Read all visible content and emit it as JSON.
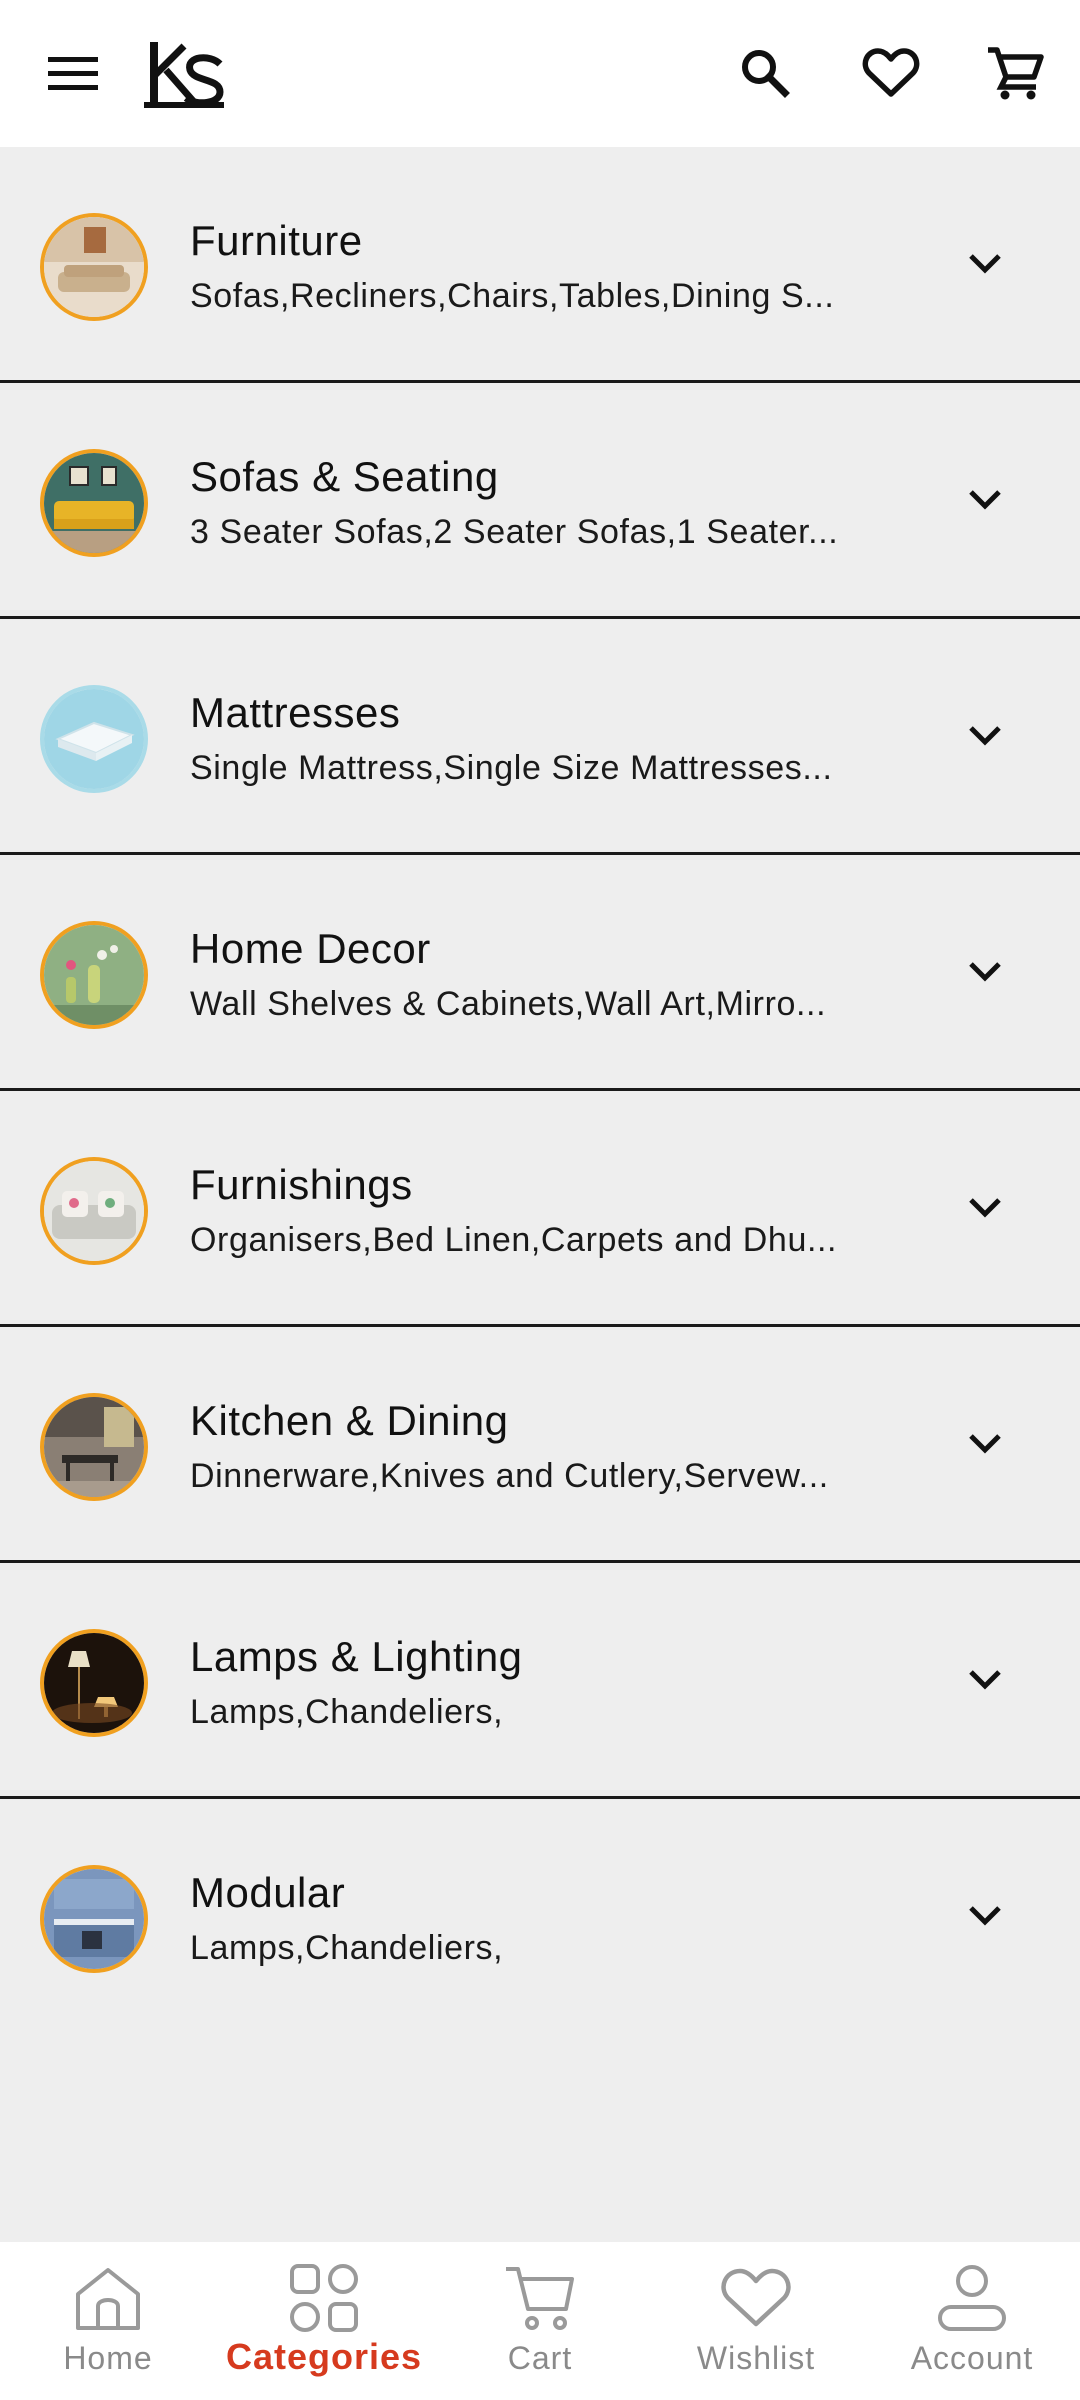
{
  "header": {
    "menu_icon": "hamburger-menu-icon",
    "logo_text": "KS",
    "actions": [
      {
        "name": "search",
        "icon": "search-icon"
      },
      {
        "name": "wishlist",
        "icon": "heart-icon"
      },
      {
        "name": "cart",
        "icon": "shopping-cart-icon"
      }
    ]
  },
  "categories": [
    {
      "title": "Furniture",
      "subtitle": "Sofas,Recliners,Chairs,Tables,Dining S..."
    },
    {
      "title": "Sofas & Seating",
      "subtitle": "3 Seater Sofas,2 Seater Sofas,1 Seater..."
    },
    {
      "title": "Mattresses",
      "subtitle": "Single Mattress,Single Size Mattresses..."
    },
    {
      "title": "Home Decor",
      "subtitle": "Wall Shelves & Cabinets,Wall Art,Mirro..."
    },
    {
      "title": "Furnishings",
      "subtitle": "Organisers,Bed Linen,Carpets and Dhu..."
    },
    {
      "title": "Kitchen & Dining",
      "subtitle": "Dinnerware,Knives and Cutlery,Servew..."
    },
    {
      "title": "Lamps & Lighting",
      "subtitle": "Lamps,Chandeliers,"
    },
    {
      "title": "Modular",
      "subtitle": "Lamps,Chandeliers,"
    }
  ],
  "bottom_nav": {
    "active": "Categories",
    "items": [
      {
        "label": "Home",
        "icon": "home-icon"
      },
      {
        "label": "Categories",
        "icon": "grid-icon"
      },
      {
        "label": "Cart",
        "icon": "cart-icon"
      },
      {
        "label": "Wishlist",
        "icon": "heart-icon"
      },
      {
        "label": "Account",
        "icon": "user-icon"
      }
    ]
  },
  "colors": {
    "accent": "#d63a1e",
    "thumb_ring": "#f0a020",
    "background": "#eeeeee",
    "inactive_nav": "#8a8a8a"
  }
}
